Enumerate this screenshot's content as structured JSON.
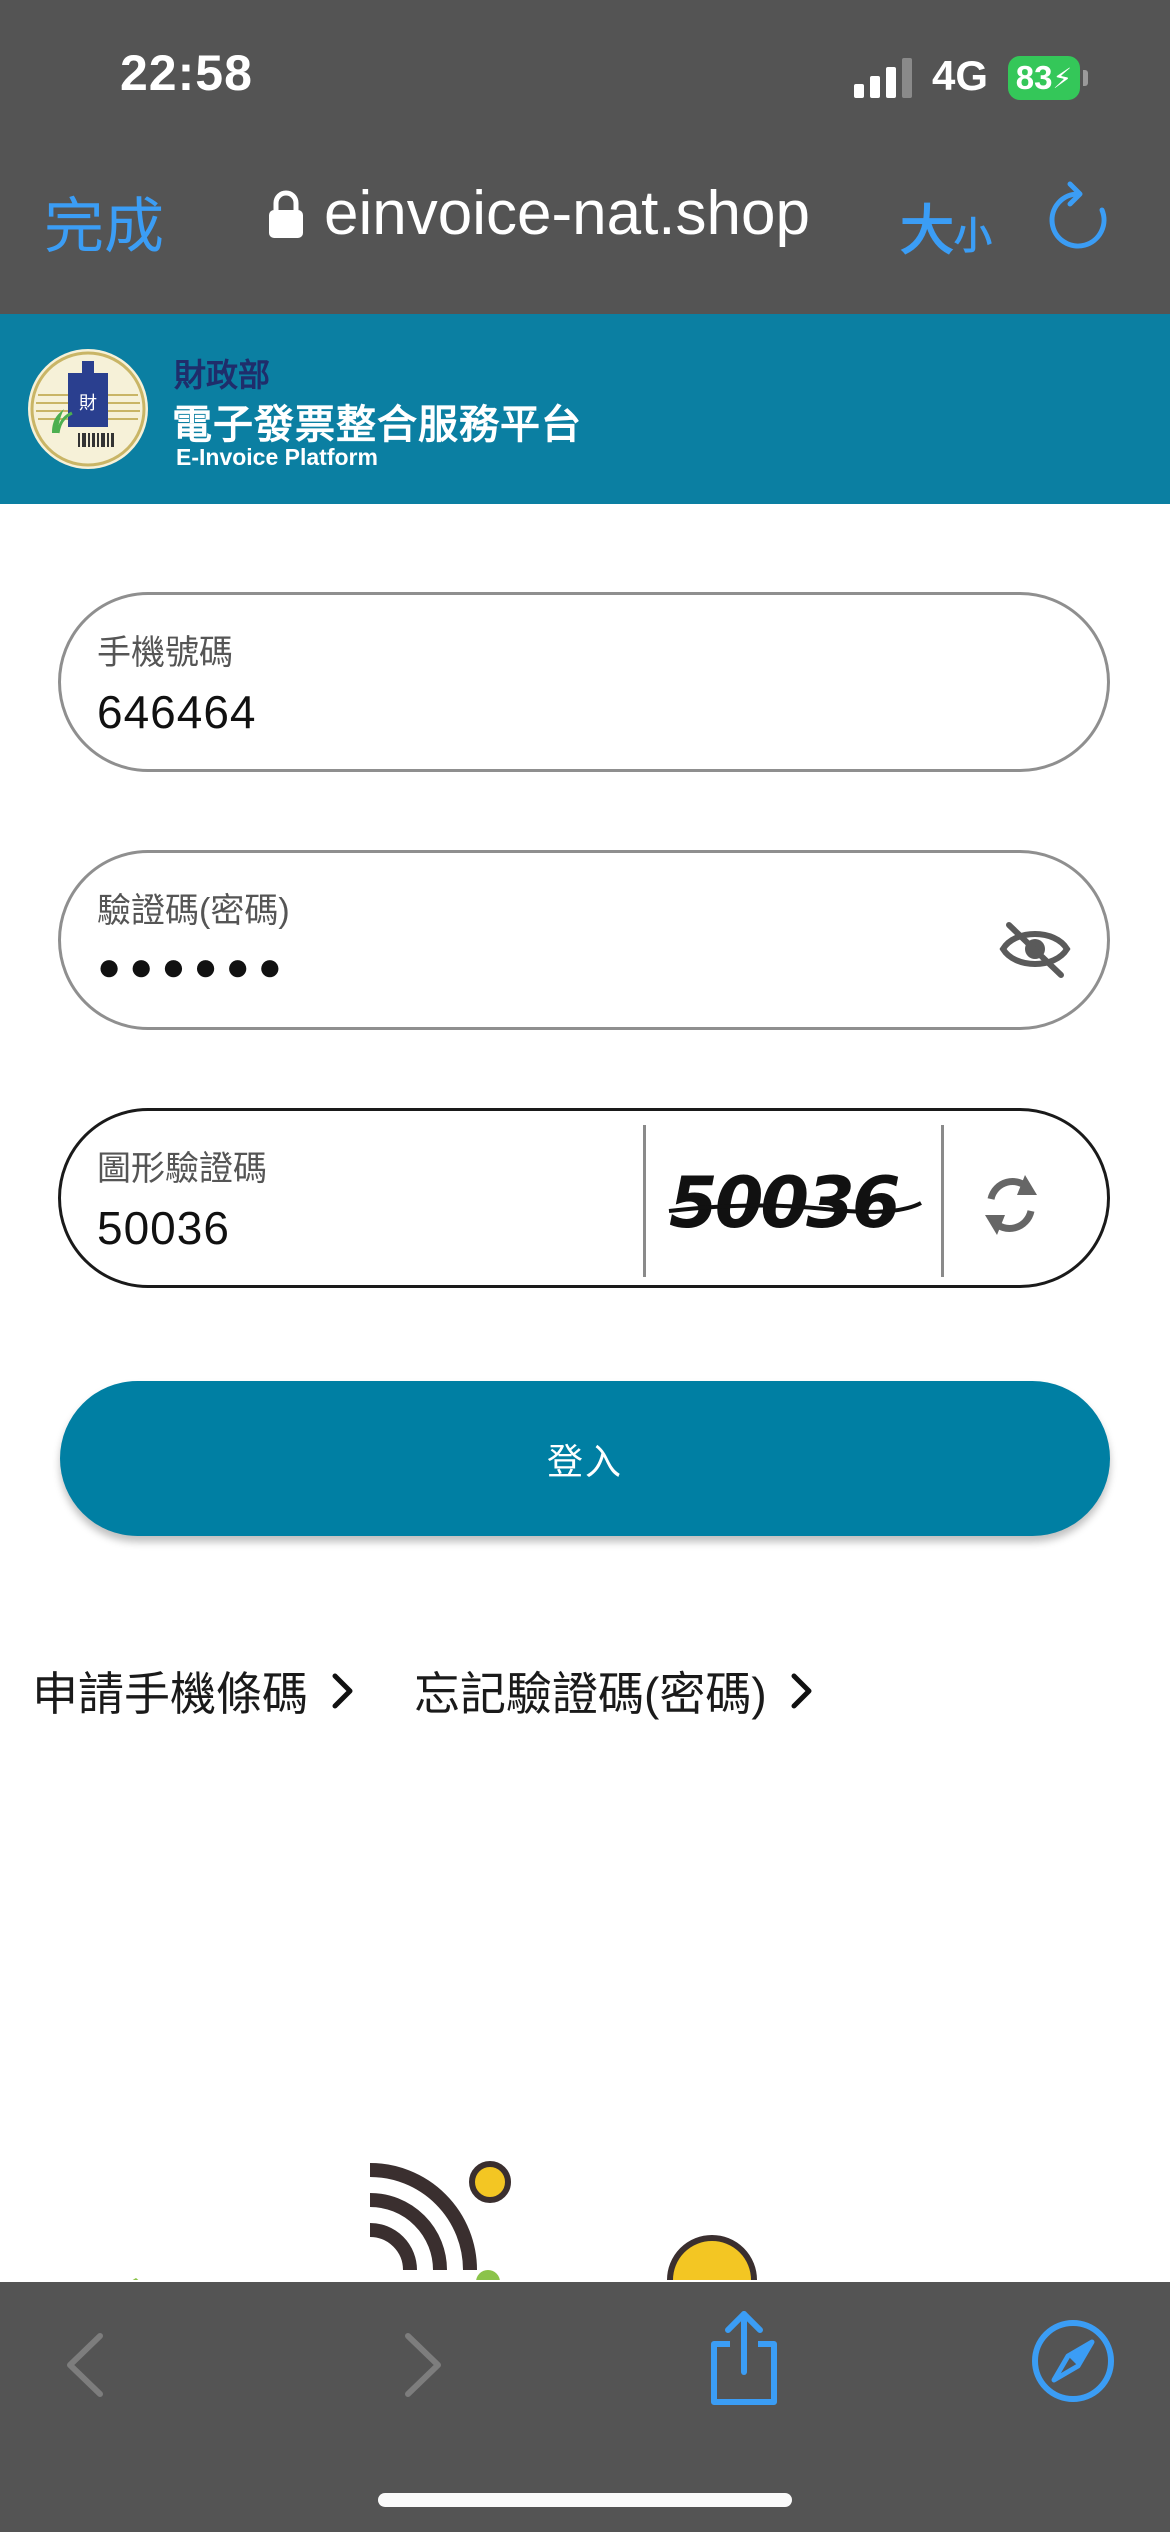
{
  "status_bar": {
    "time": "22:58",
    "network": "4G",
    "battery": "83"
  },
  "browser": {
    "done_label": "完成",
    "url": "einvoice-nat.shop",
    "text_size_big": "大",
    "text_size_small": "小"
  },
  "header": {
    "ministry": "財政部",
    "platform_name": "電子發票整合服務平台",
    "platform_name_en": "E-Invoice Platform"
  },
  "form": {
    "phone": {
      "label": "手機號碼",
      "value": "646464"
    },
    "password": {
      "label": "驗證碼(密碼)",
      "masked_value": "●●●●●●"
    },
    "captcha": {
      "label": "圖形驗證碼",
      "value": "50036",
      "image_text": "50036"
    },
    "login_label": "登入"
  },
  "links": {
    "apply_barcode": "申請手機條碼",
    "forgot_password": "忘記驗證碼(密碼)"
  },
  "colors": {
    "banner": "#0b7fa2",
    "button": "#007fa3",
    "ios_blue": "#3b9df5",
    "chrome": "#545454"
  },
  "icons": {
    "lock": "lock-icon",
    "reload": "reload-icon",
    "eye_off": "eye-off-icon",
    "refresh": "refresh-icon",
    "chevron": "chevron-right-icon",
    "back": "back-icon",
    "forward": "forward-icon",
    "share": "share-icon",
    "compass": "compass-icon"
  }
}
